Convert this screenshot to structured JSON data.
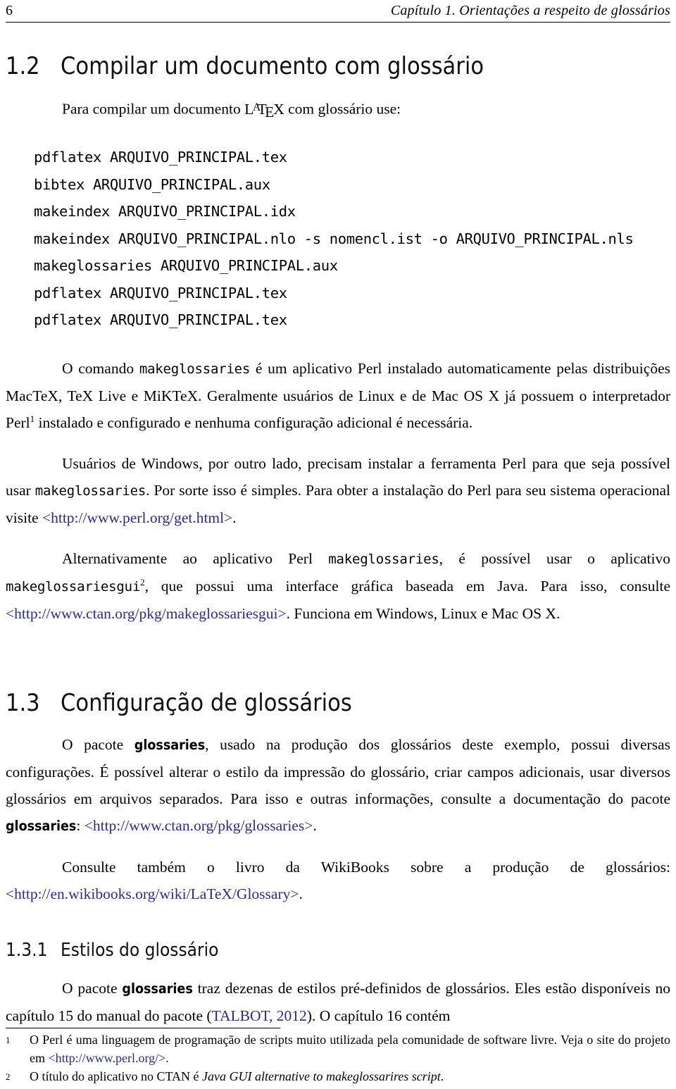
{
  "header": {
    "folio": "6",
    "chapter_title": "Capítulo 1.   Orientações a respeito de glossários"
  },
  "sections": {
    "s12": {
      "number": "1.2",
      "title": "Compilar um documento com glossário"
    },
    "s13": {
      "number": "1.3",
      "title": "Configuração de glossários"
    },
    "s131": {
      "number": "1.3.1",
      "title": "Estilos do glossário"
    }
  },
  "intro": {
    "before_latex": "Para compilar um documento ",
    "latex": "LaTeX",
    "after_latex": " com glossário use:"
  },
  "code_block": {
    "lines": [
      "pdflatex ARQUIVO_PRINCIPAL.tex",
      "bibtex ARQUIVO_PRINCIPAL.aux",
      "makeindex ARQUIVO_PRINCIPAL.idx",
      "makeindex ARQUIVO_PRINCIPAL.nlo -s nomencl.ist -o ARQUIVO_PRINCIPAL.nls",
      "makeglossaries ARQUIVO_PRINCIPAL.aux",
      "pdflatex ARQUIVO_PRINCIPAL.tex",
      "pdflatex ARQUIVO_PRINCIPAL.tex"
    ]
  },
  "para_makeglossaries": {
    "t1": "O comando ",
    "code1": "makeglossaries",
    "t2": " é um aplicativo Perl instalado automaticamente pelas distribuições MacTeX, TeX Live e MiKTeX. Geralmente usuários de Linux e de Mac OS X já possuem o interpretador Perl",
    "fnmark": "1",
    "t3": " instalado e configurado e nenhuma configuração adicional é necessária."
  },
  "para_windows": {
    "t1": "Usuários de Windows, por outro lado, precisam instalar a ferramenta Perl para que seja possível usar ",
    "code1": "makeglossaries",
    "t2": ". Por sorte isso é simples. Para obter a instalação do Perl para seu sistema operacional visite ",
    "link1": "<http://www.perl.org/get.html>",
    "t3": "."
  },
  "para_gui": {
    "t1": "Alternativamente ao aplicativo Perl ",
    "code1": "makeglossaries",
    "t2": ", é possível usar o aplicativo ",
    "code2": "makeglossariesgui",
    "fnmark": "2",
    "t3": ", que possui uma interface gráfica baseada em Java. Para isso, consulte ",
    "link1": "<http://www.ctan.org/pkg/makeglossariesgui>",
    "t4": ". Funciona em Windows, Linux e Mac OS X."
  },
  "para_config": {
    "t1": "O pacote ",
    "pkg1": "glossaries",
    "t2": ", usado na produção dos glossários deste exemplo, possui diversas configurações. É possível alterar o estilo da impressão do glossário, criar campos adicionais, usar diversos glossários em arquivos separados. Para isso e outras informações, consulte a documentação do pacote ",
    "pkg2": "glossaries",
    "t3": ": ",
    "link1": "<http://www.ctan.org/pkg/glossaries>",
    "t4": "."
  },
  "para_wikibooks": {
    "t1": "Consulte também o livro da WikiBooks sobre a produção de glossários: ",
    "link1": "<http://en.wikibooks.org/wiki/LaTeX/Glossary>",
    "t2": "."
  },
  "para_styles": {
    "t1": "O pacote ",
    "pkg1": "glossaries",
    "t2": " traz dezenas de estilos pré-definidos de glossários. Eles estão disponíveis no capítulo 15 do manual do pacote (",
    "cite1": "TALBOT, 2012",
    "t3": "). O capítulo 16 contém"
  },
  "footnotes": [
    {
      "num": "1",
      "t1": "O Perl é uma linguagem de programação de scripts muito utilizada pela comunidade de software livre. Veja o site do projeto em ",
      "link": "<http://www.perl.org/>",
      "t2": "."
    },
    {
      "num": "2",
      "t1": "O título do aplicativo no CTAN é ",
      "italic": "Java GUI alternative to makeglossarires script",
      "t2": "."
    }
  ],
  "colors": {
    "link": "#2b2b8f",
    "text": "#000000",
    "background": "#ffffff"
  }
}
